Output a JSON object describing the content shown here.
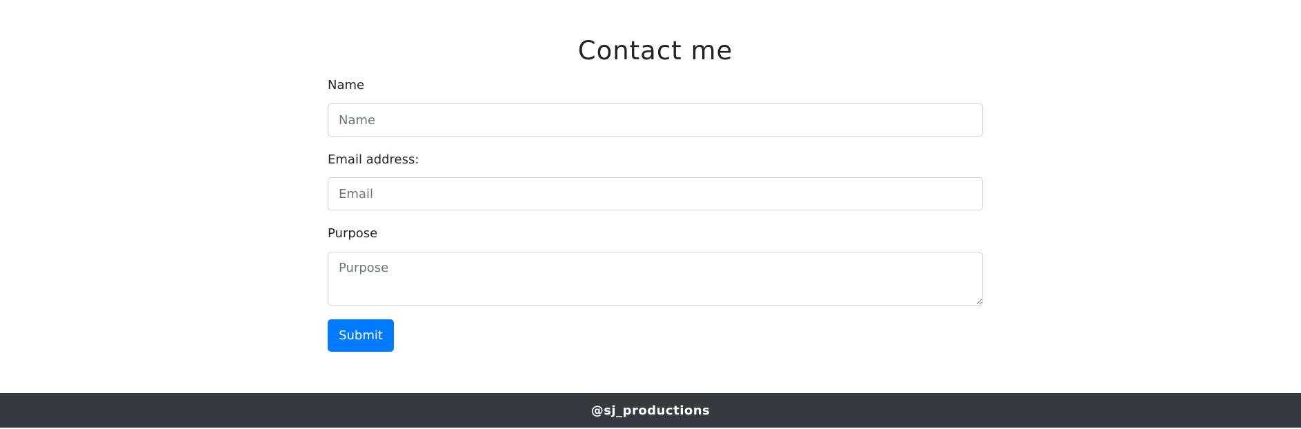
{
  "page": {
    "title": "Contact me"
  },
  "form": {
    "name": {
      "label": "Name",
      "placeholder": "Name",
      "value": ""
    },
    "email": {
      "label": "Email address:",
      "placeholder": "Email",
      "value": ""
    },
    "purpose": {
      "label": "Purpose",
      "placeholder": "Purpose",
      "value": ""
    },
    "submit_label": "Submit"
  },
  "footer": {
    "text": "@sj_productions"
  },
  "colors": {
    "accent": "#007bff",
    "footer_bg": "#343a40",
    "input_border": "#ced4da"
  }
}
